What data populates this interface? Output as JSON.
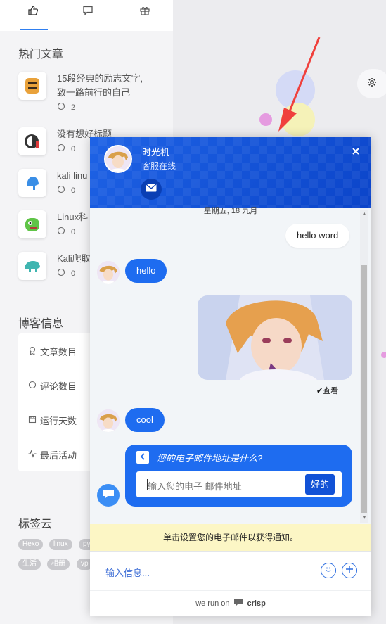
{
  "sidebar": {
    "tabs": [
      {
        "icon": "thumbs-up-icon"
      },
      {
        "icon": "comment-icon"
      },
      {
        "icon": "gift-icon"
      }
    ],
    "hot_articles_title": "热门文章",
    "articles": [
      {
        "title_line1": "15段经典的励志文字,",
        "title_line2": "致一路前行的自己",
        "comments": "2"
      },
      {
        "title_line1": "没有想好标题",
        "comments": "0"
      },
      {
        "title_line1": "kali linu",
        "comments": "0"
      },
      {
        "title_line1": "Linux科",
        "comments": "0"
      },
      {
        "title_line1": "Kali爬取",
        "comments": "0"
      }
    ],
    "blog_info_title": "博客信息",
    "blog_info": [
      {
        "label": "文章数目",
        "icon": "award-icon"
      },
      {
        "label": "评论数目",
        "icon": "comment-icon"
      },
      {
        "label": "运行天数",
        "icon": "calendar-icon"
      },
      {
        "label": "最后活动",
        "icon": "activity-icon"
      }
    ],
    "tag_cloud_title": "标签云",
    "tags": [
      "Hexo",
      "linux",
      "py",
      "生活",
      "相册",
      "vp"
    ]
  },
  "chat": {
    "agent_name": "时光机",
    "agent_status": "客服在线",
    "date_separator": "星期五, 18 九月",
    "messages": [
      {
        "from": "me",
        "text": "hello word"
      },
      {
        "from": "operator",
        "text": "hello"
      },
      {
        "from": "me",
        "type": "image"
      },
      {
        "from": "operator",
        "text": "cool"
      }
    ],
    "seen_label": "查看",
    "email_prompt": {
      "question": "您的电子邮件地址是什么?",
      "input_placeholder": "输入您的电子 邮件地址",
      "submit_label": "好的"
    },
    "notice": "单击设置您的电子邮件以获得通知。",
    "composer_placeholder": "输入信息...",
    "footer_text": "we run on",
    "footer_brand": "crisp"
  },
  "colors": {
    "accent": "#1e6cf0",
    "header_dark": "#0b44c9",
    "notice_bg": "#fcf6c5",
    "annotation_arrow": "#f0403c"
  }
}
